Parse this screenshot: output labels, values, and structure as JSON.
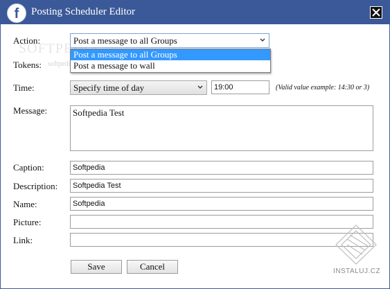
{
  "window": {
    "title": "Posting Scheduler Editor"
  },
  "watermark": {
    "text": "SOFTPEDIA",
    "sub": "softpedia"
  },
  "form": {
    "action": {
      "label": "Action:",
      "value": "Post a message to all Groups",
      "options": [
        "Post a message to all Groups",
        "Post a message to wall"
      ]
    },
    "tokens": {
      "label": "Tokens:"
    },
    "time": {
      "label": "Time:",
      "mode_value": "Specify time of day",
      "time_value": "19:00",
      "hint": "(Valid value example: 14:30 or 3)"
    },
    "message": {
      "label": "Message:",
      "value": "Softpedia Test"
    },
    "caption": {
      "label": "Caption:",
      "value": "Softpedia"
    },
    "description": {
      "label": "Description:",
      "value": "Softpedia Test"
    },
    "name": {
      "label": "Name:",
      "value": "Softpedia"
    },
    "picture": {
      "label": "Picture:",
      "value": ""
    },
    "link": {
      "label": "Link:",
      "value": ""
    }
  },
  "buttons": {
    "save": "Save",
    "cancel": "Cancel"
  },
  "brand": {
    "instaluj": "INSTALUJ.CZ"
  },
  "colors": {
    "titlebar": "#3b5998",
    "selection": "#3399ff"
  },
  "icons": {
    "app": "facebook-icon",
    "close": "close-icon",
    "dropdown": "chevron-down-icon"
  }
}
